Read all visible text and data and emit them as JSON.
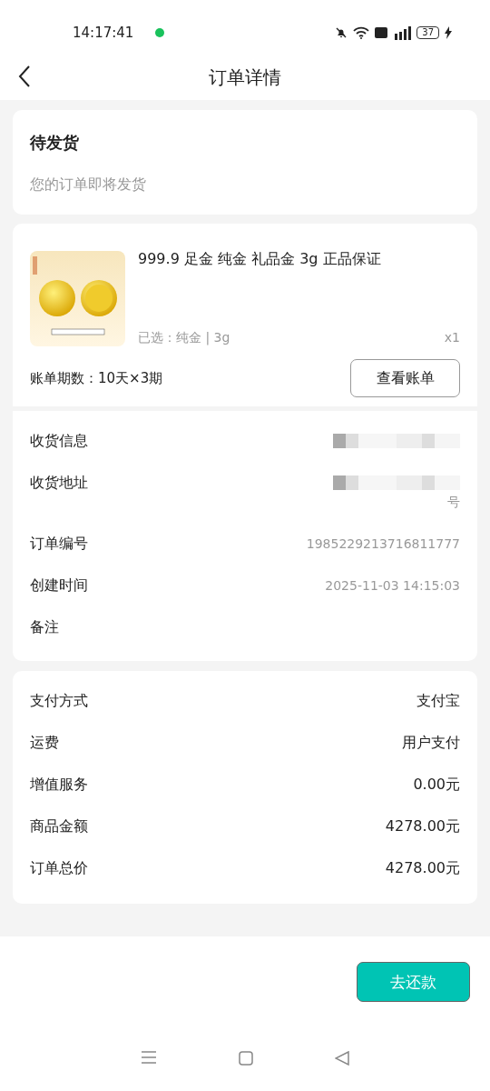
{
  "status_bar": {
    "time": "14:17:41",
    "battery": "37"
  },
  "nav": {
    "title": "订单详情"
  },
  "status_card": {
    "title": "待发货",
    "subtitle": "您的订单即将发货"
  },
  "product": {
    "kind": "picture",
    "name": "999.9 足金 纯金 礼品金 3g 正品保证",
    "spec": "已选：纯金 | 3g",
    "quantity": "x1",
    "installments": "账单期数：10天×3期",
    "bill_button": "查看账单"
  },
  "shipping": [
    {
      "label": "收货信息",
      "kind": "redacted"
    },
    {
      "label": "收货地址",
      "kind": "redacted",
      "value": "号"
    },
    {
      "label": "订单编号",
      "kind": "text",
      "value": "1985229213716811777"
    },
    {
      "label": "创建时间",
      "kind": "text",
      "value": "2025-11-03 14:15:03"
    },
    {
      "label": "备注",
      "kind": "text"
    }
  ],
  "payment": [
    {
      "label": "支付方式",
      "value": "支付宝"
    },
    {
      "label": "运费",
      "value": "用户支付"
    },
    {
      "label": "增值服务",
      "value": "0.00元"
    },
    {
      "label": "商品金额",
      "value": "4278.00元"
    },
    {
      "label": "订单总价",
      "value": "4278.00元"
    }
  ],
  "footer": {
    "pay_button": "去还款"
  }
}
